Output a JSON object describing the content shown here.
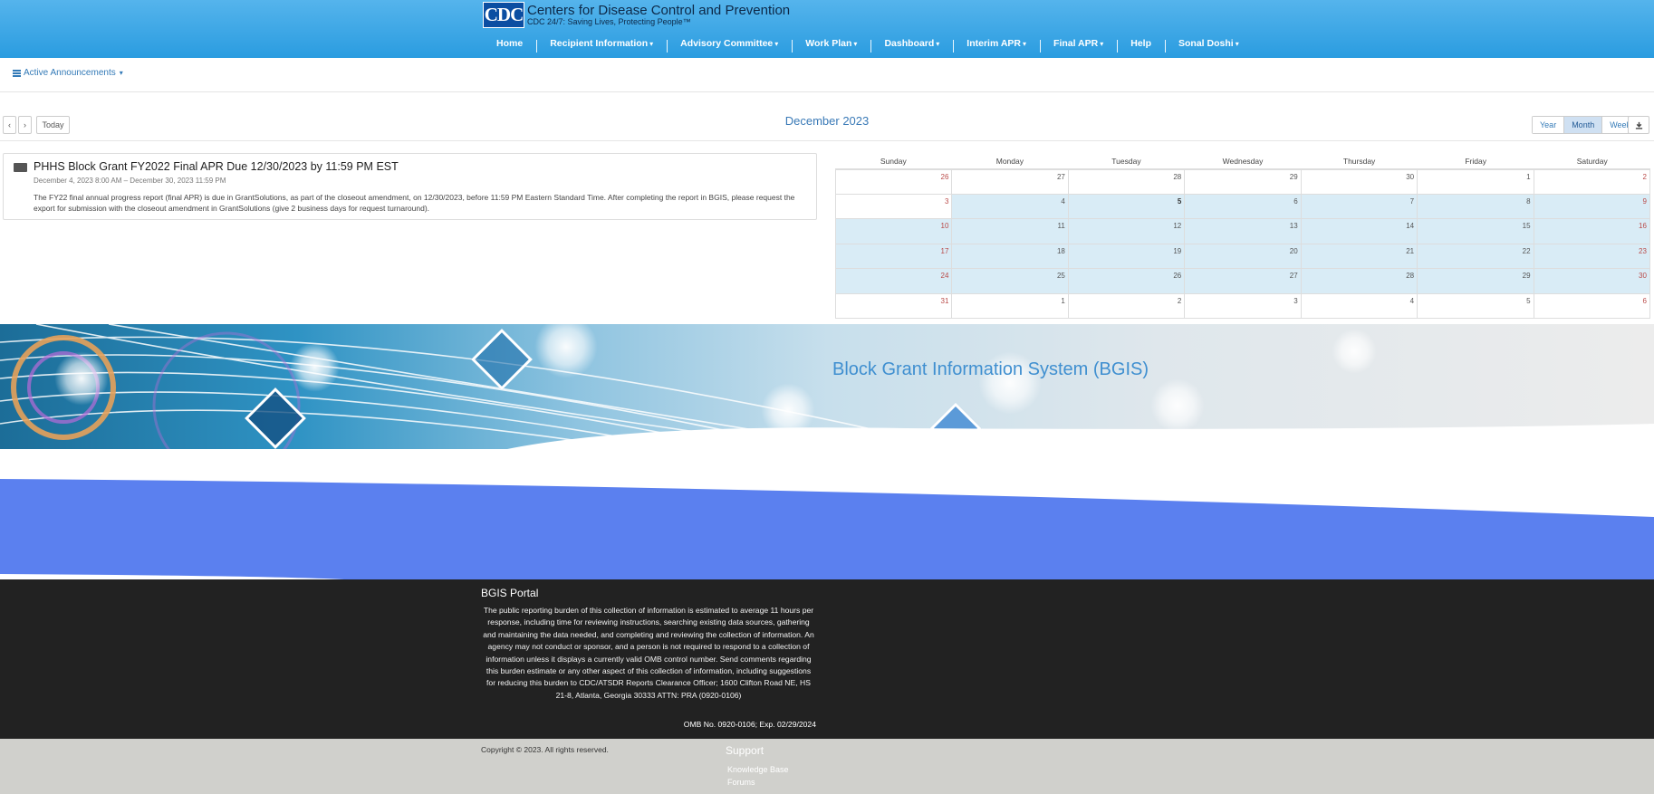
{
  "header": {
    "logo_text": "CDC",
    "org_name": "Centers for Disease Control and Prevention",
    "tagline": "CDC 24/7: Saving Lives, Protecting People™",
    "nav": [
      {
        "label": "Home",
        "dropdown": false
      },
      {
        "label": "Recipient Information",
        "dropdown": true
      },
      {
        "label": "Advisory Committee",
        "dropdown": true
      },
      {
        "label": "Work Plan",
        "dropdown": true
      },
      {
        "label": "Dashboard",
        "dropdown": true
      },
      {
        "label": "Interim APR",
        "dropdown": true
      },
      {
        "label": "Final APR",
        "dropdown": true
      },
      {
        "label": "Help",
        "dropdown": false
      },
      {
        "label": "Sonal Doshi",
        "dropdown": true
      }
    ],
    "caret_glyph": "▾"
  },
  "announcements": {
    "toggle_label": "Active Announcements"
  },
  "calendar": {
    "prev_label": "‹",
    "next_label": "›",
    "today_label": "Today",
    "title": "December 2023",
    "views": [
      "Year",
      "Month",
      "Week"
    ],
    "active_view": "Month",
    "download_icon": "download-icon",
    "weekdays": [
      "Sunday",
      "Monday",
      "Tuesday",
      "Wednesday",
      "Thursday",
      "Friday",
      "Saturday"
    ],
    "weeks": [
      [
        "26",
        "27",
        "28",
        "29",
        "30",
        "1",
        "2"
      ],
      [
        "3",
        "4",
        "5",
        "6",
        "7",
        "8",
        "9"
      ],
      [
        "10",
        "11",
        "12",
        "13",
        "14",
        "15",
        "16"
      ],
      [
        "17",
        "18",
        "19",
        "20",
        "21",
        "22",
        "23"
      ],
      [
        "24",
        "25",
        "26",
        "27",
        "28",
        "29",
        "30"
      ],
      [
        "31",
        "1",
        "2",
        "3",
        "4",
        "5",
        "6"
      ]
    ],
    "highlight_color": "#d9ecf6"
  },
  "announcement": {
    "title": "PHHS Block Grant FY2022 Final APR Due 12/30/2023 by 11:59 PM EST",
    "date_range": "December 4, 2023 8:00 AM – December 30, 2023 11:59 PM",
    "body": "The FY22 final annual progress report (final APR) is due in GrantSolutions, as part of the closeout amendment, on 12/30/2023, before 11:59 PM Eastern Standard Time. After completing the report in BGIS, please request the export for submission with the closeout amendment in GrantSolutions (give 2 business days for request turnaround)."
  },
  "banner": {
    "title": "Block Grant Information System (BGIS)"
  },
  "footer": {
    "title": "BGIS Portal",
    "burden_text": "The public reporting burden of this collection of information is estimated to average 11 hours per response, including time for reviewing instructions, searching existing data sources, gathering and maintaining the data needed, and completing and reviewing the collection of information. An agency may not conduct or sponsor, and a person is not required to respond to a collection of information unless it displays a currently valid OMB control number. Send comments regarding this burden estimate or any other aspect of this collection of information, including suggestions for reducing this burden to CDC/ATSDR Reports Clearance Officer; 1600 Clifton Road NE, HS 21-8, Atlanta, Georgia 30333 ATTN: PRA (0920-0106)",
    "omb": "OMB No. 0920-0106; Exp. 02/29/2024",
    "copyright": "Copyright © 2023. All rights reserved.",
    "support_title": "Support",
    "support_links": [
      "Knowledge Base",
      "Forums"
    ]
  },
  "colors": {
    "header_blue": "#2a9ce0",
    "link_blue": "#337ab7",
    "wave_blue": "#5b80ef",
    "footer_dark": "#222222",
    "subfooter_gray": "#d0d0cc"
  }
}
